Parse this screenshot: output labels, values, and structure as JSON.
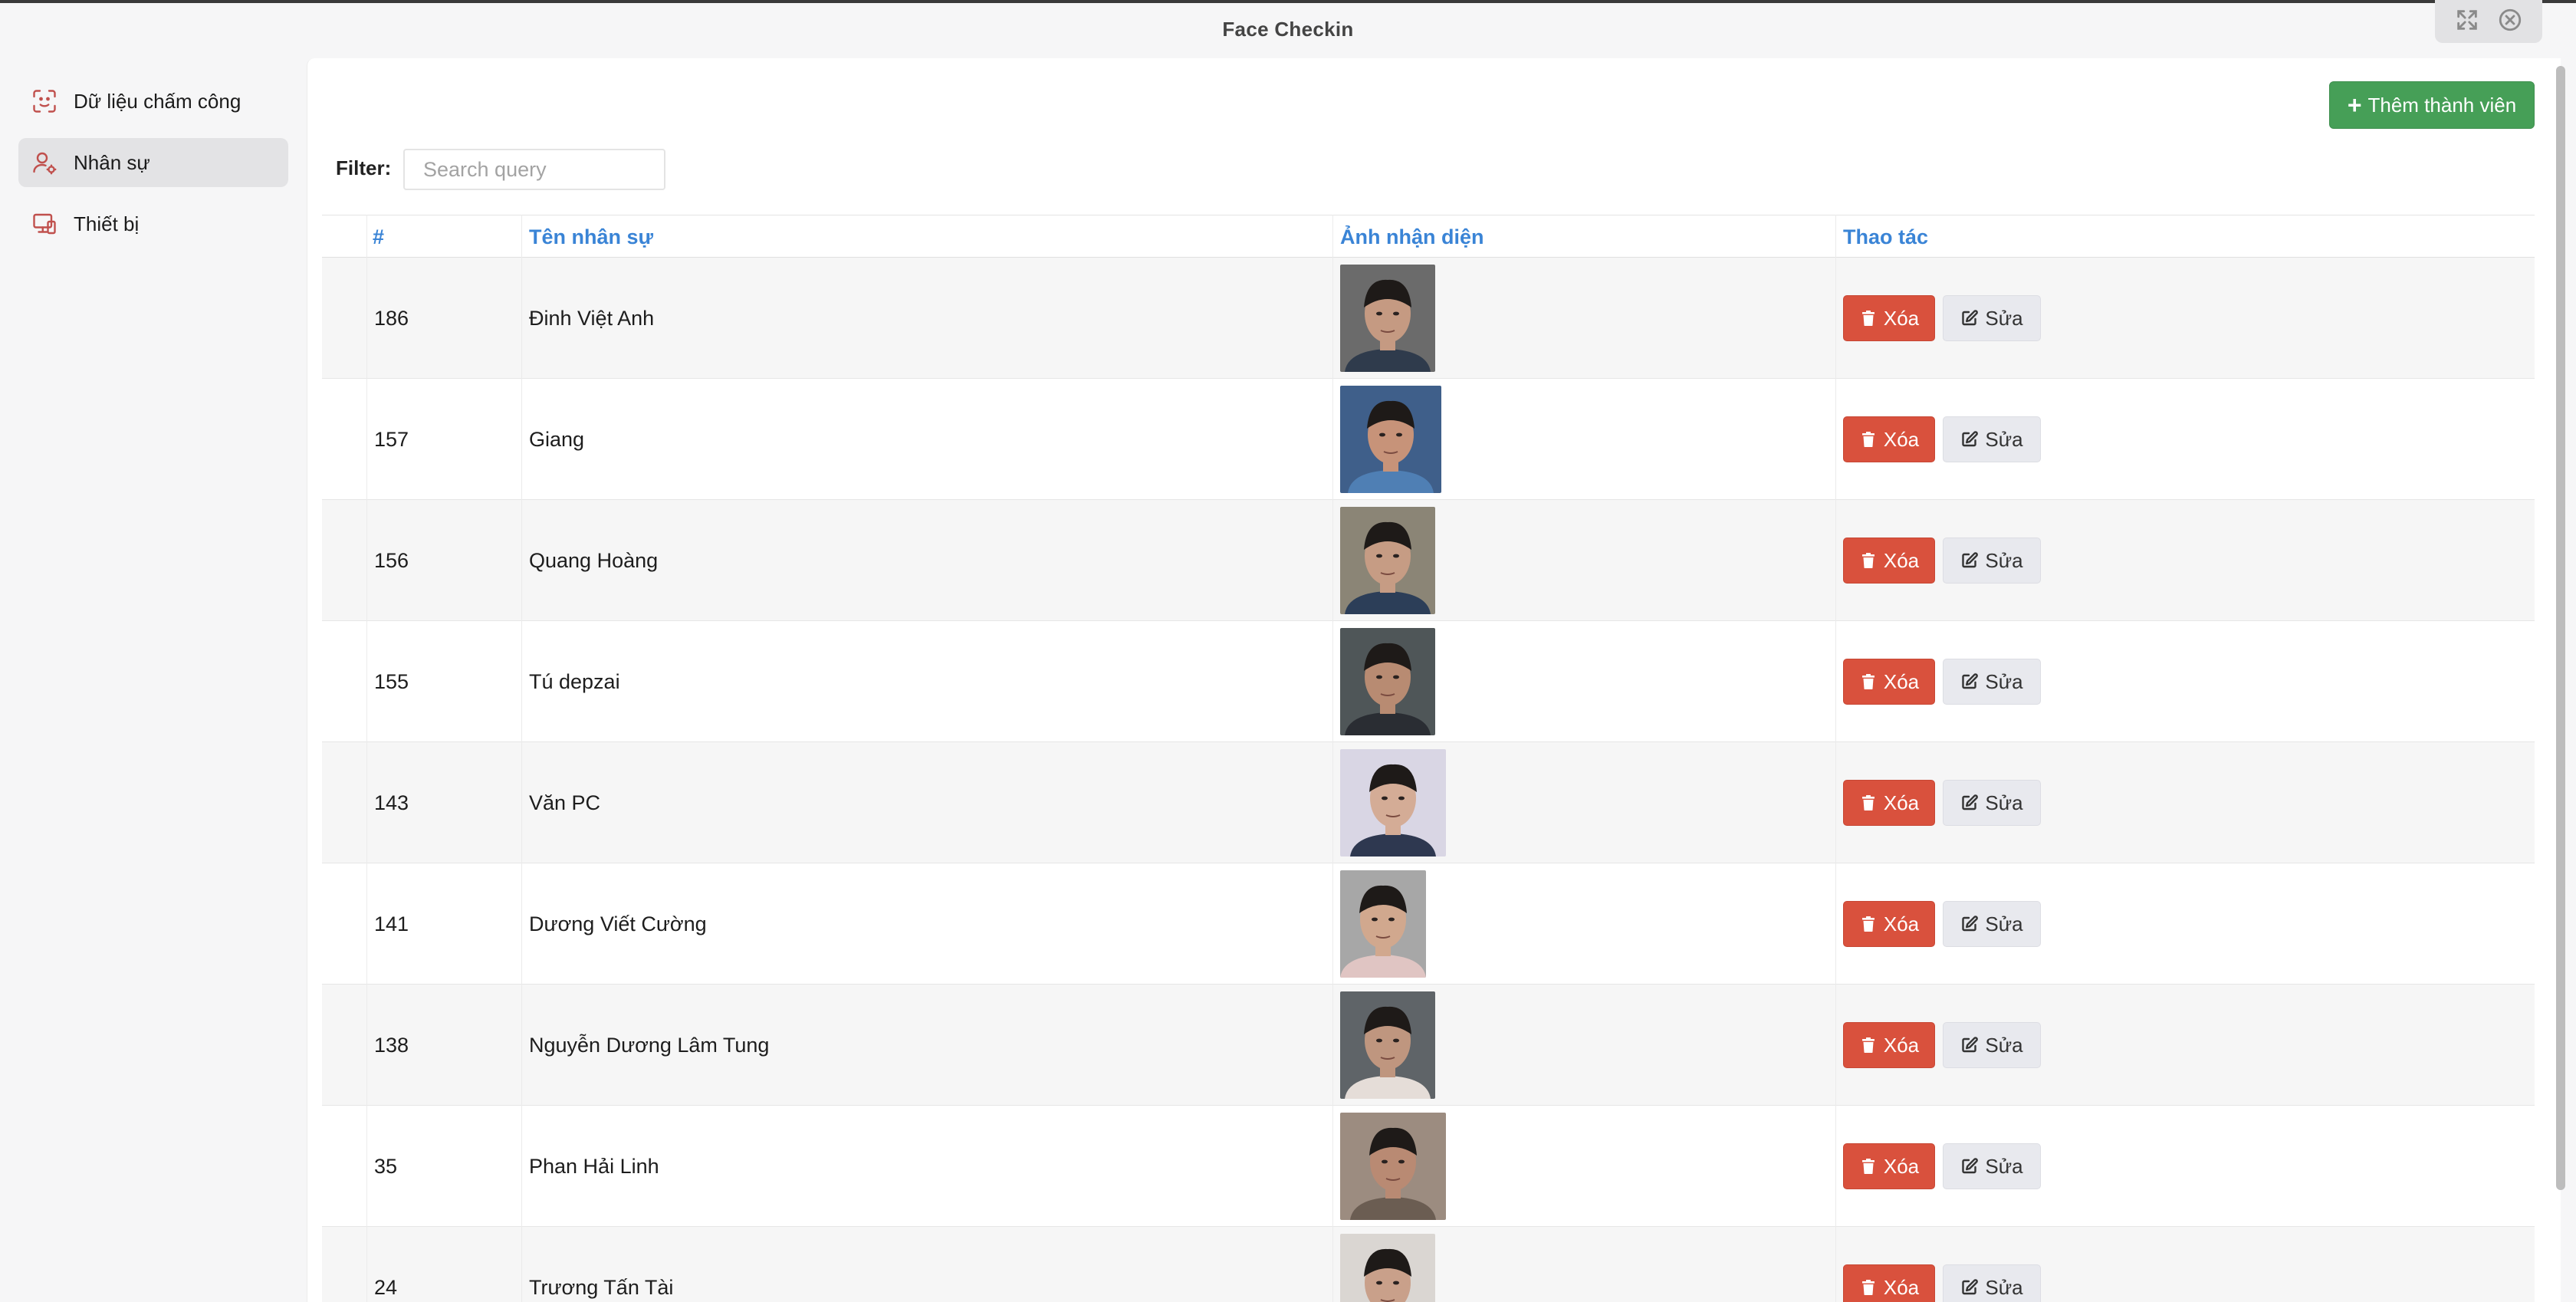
{
  "window": {
    "title": "Face Checkin"
  },
  "window_controls": {
    "icons": [
      "expand-icon",
      "close-circle-icon"
    ]
  },
  "sidebar": {
    "items": [
      {
        "label": "Dữ liệu chấm công",
        "icon": "face-scan-icon",
        "active": false
      },
      {
        "label": "Nhân sự",
        "icon": "user-settings-icon",
        "active": true
      },
      {
        "label": "Thiết bị",
        "icon": "devices-icon",
        "active": false
      }
    ]
  },
  "toolbar": {
    "add_label": "Thêm thành viên",
    "add_icon": "plus-icon",
    "add_color": "#469f57"
  },
  "filter": {
    "label": "Filter:",
    "placeholder": "Search query",
    "value": ""
  },
  "table": {
    "headers": {
      "id": "#",
      "name": "Tên nhân sự",
      "photo": "Ảnh nhận diện",
      "actions": "Thao tác"
    },
    "header_color": "#3a84d6",
    "delete_label": "Xóa",
    "edit_label": "Sửa",
    "delete_color": "#d9513d",
    "rows": [
      {
        "id": "186",
        "name": "Đinh Việt Anh"
      },
      {
        "id": "157",
        "name": "Giang"
      },
      {
        "id": "156",
        "name": "Quang Hoàng"
      },
      {
        "id": "155",
        "name": "Tú depzai"
      },
      {
        "id": "143",
        "name": "Văn PC"
      },
      {
        "id": "141",
        "name": "Dương Viết Cường"
      },
      {
        "id": "138",
        "name": "Nguyễn Dương Lâm Tung"
      },
      {
        "id": "35",
        "name": "Phan Hải Linh"
      },
      {
        "id": "24",
        "name": "Trương Tấn Tài"
      }
    ]
  }
}
